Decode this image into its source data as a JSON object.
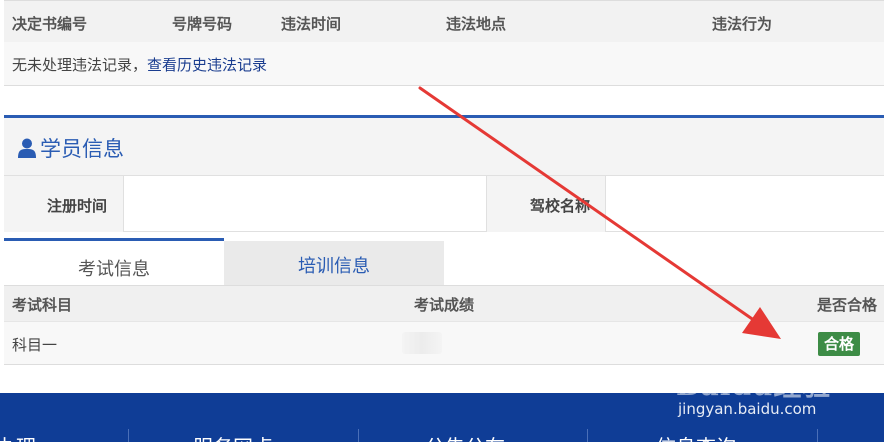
{
  "violations": {
    "headers": [
      "决定书编号",
      "号牌号码",
      "违法时间",
      "违法地点",
      "违法行为"
    ],
    "empty_text": "无未处理违法记录，",
    "history_link": "查看历史违法记录"
  },
  "student": {
    "title": "学员信息",
    "register_label": "注册时间",
    "register_value": "",
    "school_label": "驾校名称",
    "school_value": ""
  },
  "tabs": {
    "exam": "考试信息",
    "training": "培训信息"
  },
  "exam": {
    "headers": [
      "考试科目",
      "考试成绩",
      "是否合格"
    ],
    "rows": [
      {
        "subject": "科目一",
        "score": "",
        "pass": "合格"
      }
    ]
  },
  "footer": {
    "nav": [
      "办理",
      "服务网点",
      "公告公布",
      "信息查询"
    ]
  },
  "watermark": {
    "logo": "Baidu经验",
    "url": "jingyan.baidu.com"
  },
  "colors": {
    "accent": "#2a5cb3",
    "footer": "#0f3d96",
    "pass_badge": "#3d8c46",
    "arrow": "#e53935"
  }
}
